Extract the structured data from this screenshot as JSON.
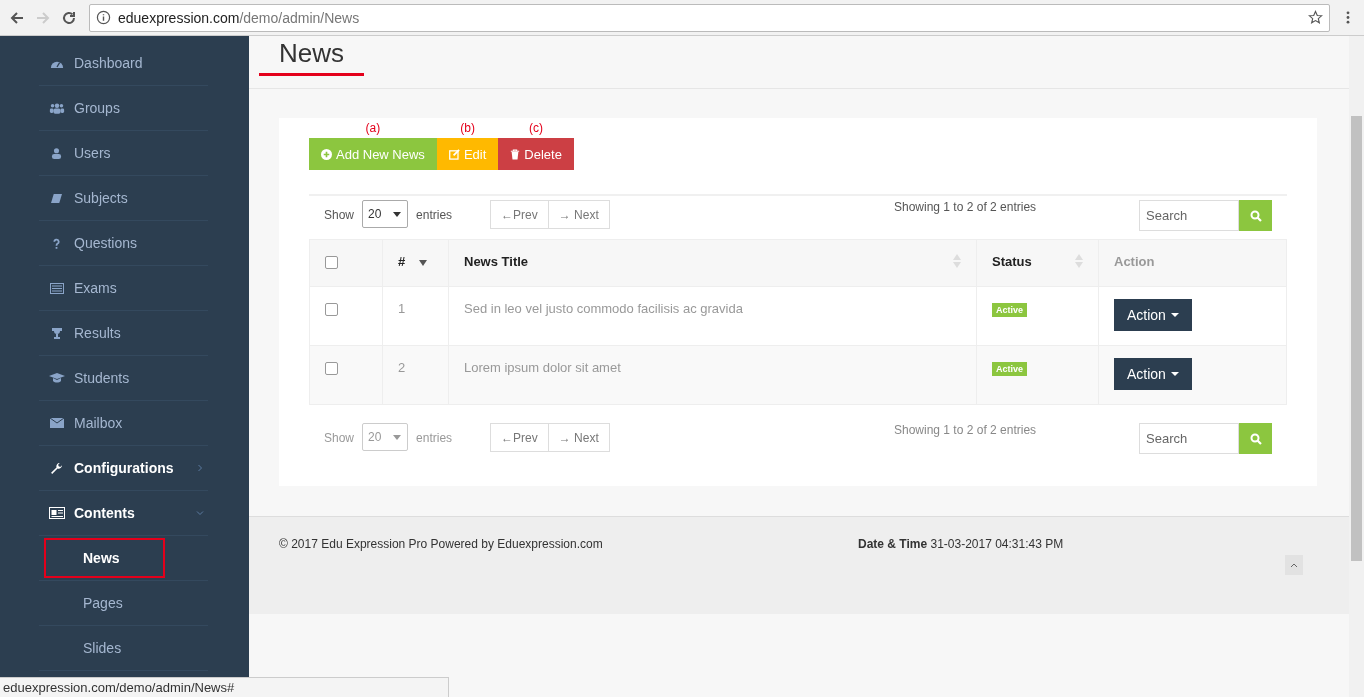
{
  "browser": {
    "url_host": "eduexpression.com",
    "url_path": "/demo/admin/News"
  },
  "sidebar": {
    "items": [
      {
        "label": "Dashboard",
        "kind": "item"
      },
      {
        "label": "Groups",
        "kind": "item"
      },
      {
        "label": "Users",
        "kind": "item"
      },
      {
        "label": "Subjects",
        "kind": "item"
      },
      {
        "label": "Questions",
        "kind": "item"
      },
      {
        "label": "Exams",
        "kind": "item"
      },
      {
        "label": "Results",
        "kind": "item"
      },
      {
        "label": "Students",
        "kind": "item"
      },
      {
        "label": "Mailbox",
        "kind": "item"
      },
      {
        "label": "Configurations",
        "kind": "group",
        "expanded": false
      },
      {
        "label": "Contents",
        "kind": "group",
        "expanded": true,
        "children": [
          {
            "label": "News",
            "selected": true
          },
          {
            "label": "Pages",
            "selected": false
          },
          {
            "label": "Slides",
            "selected": false
          }
        ]
      }
    ]
  },
  "page": {
    "title": "News"
  },
  "toolbar": [
    {
      "label": "Add New News",
      "kind": "add",
      "note": "(a)"
    },
    {
      "label": "Edit",
      "kind": "edit",
      "note": "(b)"
    },
    {
      "label": "Delete",
      "kind": "delete",
      "note": "(c)"
    }
  ],
  "table_controls": [
    {
      "show": "Show",
      "length": "20",
      "entries": "entries",
      "prev": "←Prev",
      "next": "→ Next",
      "info": "Showing 1 to 2 of 2 entries",
      "search_placeholder": "Search",
      "disabled": false
    },
    {
      "show": "Show",
      "length": "20",
      "entries": "entries",
      "prev": "←Prev",
      "next": "→ Next",
      "info": "Showing 1 to 2 of 2 entries",
      "search_placeholder": "Search",
      "disabled": true
    }
  ],
  "table": {
    "header_checkbox": {
      "checked": false
    },
    "columns": [
      {
        "label": "#",
        "sortable": true,
        "sorted": true
      },
      {
        "label": "News Title",
        "sortable": true,
        "sorted": false
      },
      {
        "label": "Status",
        "sortable": true,
        "sorted": false
      },
      {
        "label": "Action",
        "sortable": false
      }
    ],
    "rows": [
      {
        "checked": false,
        "number": "1",
        "title": "Sed in leo vel justo commodo facilisis ac gravida",
        "status": "Active",
        "action": "Action"
      },
      {
        "checked": false,
        "number": "2",
        "title": "Lorem ipsum dolor sit amet",
        "status": "Active",
        "action": "Action"
      }
    ]
  },
  "footer": {
    "copyright": "© 2017 Edu Expression Pro Powered by Eduexpression.com",
    "datetime": "**Date & Time** 31-03-2017 04:31:43 PM"
  },
  "status_bar": {
    "url": "eduexpression.com/demo/admin/News#"
  }
}
